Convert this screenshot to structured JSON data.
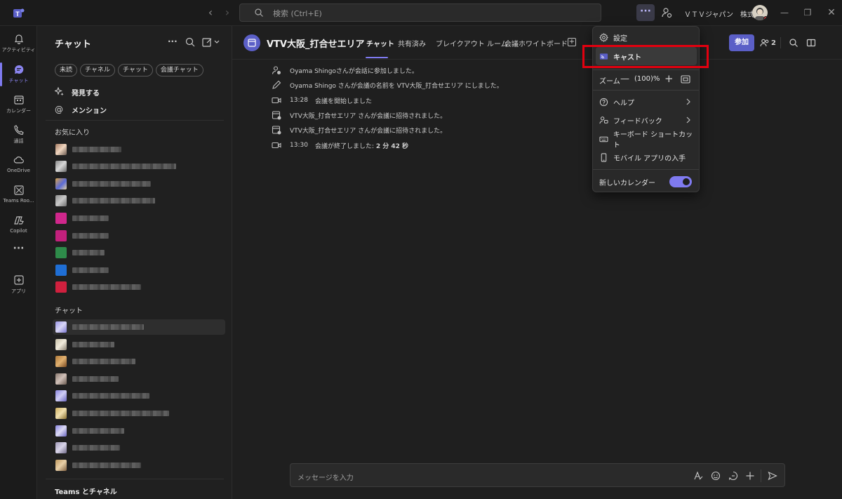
{
  "titlebar": {
    "search_placeholder": "検索 (Ctrl+E)",
    "more_label": "···",
    "org_name": "ＶＴＶジャパン　株式..."
  },
  "appbar": {
    "items": [
      {
        "label": "アクティビティ",
        "icon": "bell-icon"
      },
      {
        "label": "チャット",
        "icon": "chat-icon"
      },
      {
        "label": "カレンダー",
        "icon": "calendar-icon"
      },
      {
        "label": "通話",
        "icon": "phone-icon"
      },
      {
        "label": "OneDrive",
        "icon": "cloud-icon"
      },
      {
        "label": "Teams Roo...",
        "icon": "rooms-icon"
      },
      {
        "label": "Copilot",
        "icon": "copilot-icon"
      },
      {
        "label": "アプリ",
        "icon": "add-app-icon"
      }
    ],
    "more_label": "···"
  },
  "chat_pane": {
    "title": "チャット",
    "filters": [
      "未読",
      "チャネル",
      "チャット",
      "会議チャット"
    ],
    "nav": [
      {
        "label": "発見する",
        "icon": "sparkle-icon"
      },
      {
        "label": "メンション",
        "icon": "at-icon"
      }
    ],
    "favorites_label": "お気に入り",
    "chats_label": "チャット",
    "teams_label": "Teams とチャネル"
  },
  "main": {
    "title": "VTV大阪_打合せエリア",
    "tabs": [
      "チャット",
      "共有済み",
      "ブレイクアウト ルーム",
      "会議ホワイトボード"
    ],
    "join_label": "参加",
    "participants_count": "2",
    "events": [
      {
        "icon": "person-add-icon",
        "time": "",
        "text": "Oyama Shingoさんが会話に参加しました。"
      },
      {
        "icon": "pencil-icon",
        "time": "",
        "text": "Oyama Shingo さんが会議の名前を VTV大阪_打合せエリア にしました。"
      },
      {
        "icon": "video-icon",
        "time": "13:28",
        "text": "会議を開始しました"
      },
      {
        "icon": "calendar-invite-icon",
        "time": "",
        "text": "VTV大阪_打合せエリア さんが会議に招待されました。"
      },
      {
        "icon": "calendar-invite-icon",
        "time": "",
        "text": "VTV大阪_打合せエリア さんが会議に招待されました。"
      },
      {
        "icon": "video-icon",
        "time": "13:30",
        "text": "会議が終了しました: ",
        "bold": "2 分 42 秒"
      }
    ],
    "composer_placeholder": "メッセージを入力"
  },
  "menu": {
    "settings": "設定",
    "cast": "キャスト",
    "zoom_label": "ズーム",
    "zoom_value": "(100)%",
    "help": "ヘルプ",
    "feedback": "フィードバック",
    "keyboard_shortcuts": "キーボード ショートカット",
    "mobile_app": "モバイル アプリの入手",
    "new_calendar": "新しいカレンダー",
    "new_calendar_enabled": true
  },
  "colors": {
    "accent": "#7f7af0",
    "highlight_box": "#e3000f",
    "join_button": "#5b5fc7"
  }
}
